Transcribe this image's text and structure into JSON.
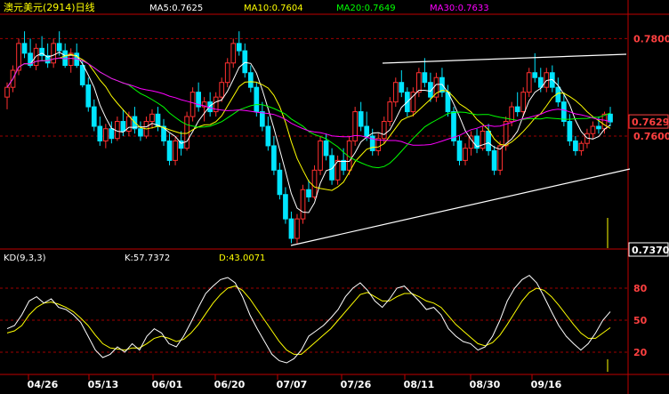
{
  "header": {
    "title": "澳元美元(2914)日线",
    "ma": [
      {
        "label": "MA5:0.7625",
        "color": "#ffffff"
      },
      {
        "label": "MA10:0.7604",
        "color": "#ffff00"
      },
      {
        "label": "MA20:0.7649",
        "color": "#00ff00"
      },
      {
        "label": "MA30:0.7633",
        "color": "#ff00ff"
      }
    ]
  },
  "kd_header": {
    "name": "KD(9,3,3)",
    "k_label": "K:57.7372",
    "d_label": "D:43.0071"
  },
  "price_axis": {
    "labels": [
      {
        "text": "0.7629",
        "value": 0.7629,
        "boxed": true,
        "color": "#ff4040"
      },
      {
        "text": "0.7800",
        "value": 0.78,
        "color": "#ff4040"
      },
      {
        "text": "0.7600",
        "value": 0.76,
        "color": "#ff4040"
      },
      {
        "text": "0.7370",
        "value": 0.737,
        "boxed": true,
        "color": "#ffffff"
      }
    ]
  },
  "kd_axis": {
    "labels": [
      {
        "text": "80",
        "value": 80
      },
      {
        "text": "50",
        "value": 50
      },
      {
        "text": "20",
        "value": 20
      }
    ]
  },
  "date_axis": [
    "04/26",
    "05/13",
    "06/01",
    "06/20",
    "07/07",
    "07/26",
    "08/11",
    "08/30",
    "09/16"
  ],
  "colors": {
    "up": "#ff3030",
    "down": "#00e5ff",
    "grid": "#a00000",
    "trend": "#ffffff"
  },
  "chart_data": {
    "type": "candlestick",
    "title": "澳元美元(2914)日线",
    "price_range": [
      0.737,
      0.785
    ],
    "kd_range": [
      0,
      100
    ],
    "categories": [
      "04/26",
      "05/13",
      "06/01",
      "06/20",
      "07/07",
      "07/26",
      "08/11",
      "08/30",
      "09/16"
    ],
    "candles": [
      [
        0.768,
        0.771,
        0.7655,
        0.77
      ],
      [
        0.77,
        0.7745,
        0.769,
        0.7735
      ],
      [
        0.7735,
        0.78,
        0.7725,
        0.779
      ],
      [
        0.779,
        0.7815,
        0.776,
        0.777
      ],
      [
        0.777,
        0.78,
        0.774,
        0.7745
      ],
      [
        0.7745,
        0.779,
        0.7735,
        0.778
      ],
      [
        0.778,
        0.7805,
        0.7755,
        0.7765
      ],
      [
        0.7765,
        0.779,
        0.774,
        0.775
      ],
      [
        0.775,
        0.78,
        0.774,
        0.779
      ],
      [
        0.779,
        0.7815,
        0.7765,
        0.7775
      ],
      [
        0.7775,
        0.779,
        0.774,
        0.7745
      ],
      [
        0.7745,
        0.778,
        0.773,
        0.777
      ],
      [
        0.777,
        0.779,
        0.774,
        0.7745
      ],
      [
        0.7745,
        0.7755,
        0.77,
        0.7705
      ],
      [
        0.7705,
        0.772,
        0.765,
        0.766
      ],
      [
        0.766,
        0.7675,
        0.761,
        0.762
      ],
      [
        0.762,
        0.764,
        0.758,
        0.759
      ],
      [
        0.759,
        0.7625,
        0.7575,
        0.7615
      ],
      [
        0.7615,
        0.763,
        0.7585,
        0.7595
      ],
      [
        0.7595,
        0.764,
        0.759,
        0.763
      ],
      [
        0.763,
        0.7655,
        0.76,
        0.761
      ],
      [
        0.761,
        0.765,
        0.76,
        0.764
      ],
      [
        0.764,
        0.766,
        0.7605,
        0.7615
      ],
      [
        0.7615,
        0.763,
        0.759,
        0.76
      ],
      [
        0.76,
        0.764,
        0.7595,
        0.763
      ],
      [
        0.763,
        0.7655,
        0.7615,
        0.7645
      ],
      [
        0.7645,
        0.766,
        0.761,
        0.762
      ],
      [
        0.762,
        0.7635,
        0.758,
        0.759
      ],
      [
        0.759,
        0.7605,
        0.754,
        0.755
      ],
      [
        0.755,
        0.76,
        0.754,
        0.759
      ],
      [
        0.759,
        0.761,
        0.756,
        0.7575
      ],
      [
        0.7575,
        0.765,
        0.757,
        0.764
      ],
      [
        0.764,
        0.77,
        0.763,
        0.769
      ],
      [
        0.769,
        0.771,
        0.765,
        0.766
      ],
      [
        0.766,
        0.768,
        0.763,
        0.767
      ],
      [
        0.767,
        0.769,
        0.764,
        0.765
      ],
      [
        0.765,
        0.769,
        0.764,
        0.768
      ],
      [
        0.768,
        0.772,
        0.767,
        0.771
      ],
      [
        0.771,
        0.776,
        0.77,
        0.775
      ],
      [
        0.775,
        0.78,
        0.774,
        0.779
      ],
      [
        0.779,
        0.7815,
        0.7765,
        0.7775
      ],
      [
        0.7775,
        0.779,
        0.772,
        0.773
      ],
      [
        0.773,
        0.7745,
        0.769,
        0.77
      ],
      [
        0.77,
        0.771,
        0.764,
        0.765
      ],
      [
        0.765,
        0.767,
        0.761,
        0.762
      ],
      [
        0.762,
        0.764,
        0.757,
        0.758
      ],
      [
        0.758,
        0.76,
        0.752,
        0.753
      ],
      [
        0.753,
        0.7545,
        0.747,
        0.748
      ],
      [
        0.748,
        0.7495,
        0.742,
        0.743
      ],
      [
        0.743,
        0.7445,
        0.738,
        0.739
      ],
      [
        0.739,
        0.744,
        0.738,
        0.743
      ],
      [
        0.743,
        0.75,
        0.742,
        0.749
      ],
      [
        0.749,
        0.751,
        0.7465,
        0.7475
      ],
      [
        0.7475,
        0.754,
        0.747,
        0.753
      ],
      [
        0.753,
        0.76,
        0.752,
        0.759
      ],
      [
        0.759,
        0.7605,
        0.755,
        0.756
      ],
      [
        0.756,
        0.7575,
        0.75,
        0.751
      ],
      [
        0.751,
        0.756,
        0.75,
        0.755
      ],
      [
        0.755,
        0.7575,
        0.752,
        0.753
      ],
      [
        0.753,
        0.76,
        0.752,
        0.759
      ],
      [
        0.759,
        0.766,
        0.758,
        0.765
      ],
      [
        0.765,
        0.767,
        0.761,
        0.762
      ],
      [
        0.762,
        0.765,
        0.759,
        0.76
      ],
      [
        0.76,
        0.7615,
        0.756,
        0.757
      ],
      [
        0.757,
        0.7605,
        0.756,
        0.7595
      ],
      [
        0.7595,
        0.764,
        0.7585,
        0.763
      ],
      [
        0.763,
        0.768,
        0.762,
        0.767
      ],
      [
        0.767,
        0.772,
        0.766,
        0.771
      ],
      [
        0.771,
        0.7735,
        0.768,
        0.769
      ],
      [
        0.769,
        0.77,
        0.764,
        0.765
      ],
      [
        0.765,
        0.77,
        0.764,
        0.769
      ],
      [
        0.769,
        0.774,
        0.768,
        0.773
      ],
      [
        0.773,
        0.776,
        0.77,
        0.771
      ],
      [
        0.771,
        0.773,
        0.767,
        0.768
      ],
      [
        0.768,
        0.773,
        0.767,
        0.772
      ],
      [
        0.772,
        0.774,
        0.768,
        0.769
      ],
      [
        0.769,
        0.7705,
        0.764,
        0.765
      ],
      [
        0.765,
        0.766,
        0.758,
        0.759
      ],
      [
        0.759,
        0.76,
        0.754,
        0.755
      ],
      [
        0.755,
        0.7585,
        0.754,
        0.7575
      ],
      [
        0.7575,
        0.761,
        0.756,
        0.76
      ],
      [
        0.76,
        0.7615,
        0.7565,
        0.7575
      ],
      [
        0.7575,
        0.762,
        0.757,
        0.761
      ],
      [
        0.761,
        0.7625,
        0.756,
        0.757
      ],
      [
        0.757,
        0.758,
        0.752,
        0.753
      ],
      [
        0.753,
        0.759,
        0.752,
        0.758
      ],
      [
        0.758,
        0.764,
        0.757,
        0.763
      ],
      [
        0.763,
        0.767,
        0.762,
        0.766
      ],
      [
        0.766,
        0.769,
        0.764,
        0.765
      ],
      [
        0.765,
        0.77,
        0.764,
        0.769
      ],
      [
        0.769,
        0.774,
        0.768,
        0.773
      ],
      [
        0.773,
        0.777,
        0.771,
        0.772
      ],
      [
        0.772,
        0.774,
        0.769,
        0.77
      ],
      [
        0.77,
        0.774,
        0.769,
        0.773
      ],
      [
        0.773,
        0.7745,
        0.769,
        0.77
      ],
      [
        0.77,
        0.772,
        0.766,
        0.767
      ],
      [
        0.767,
        0.769,
        0.762,
        0.763
      ],
      [
        0.763,
        0.7645,
        0.758,
        0.759
      ],
      [
        0.759,
        0.76,
        0.756,
        0.757
      ],
      [
        0.757,
        0.759,
        0.756,
        0.7585
      ],
      [
        0.7585,
        0.7615,
        0.7575,
        0.7605
      ],
      [
        0.7605,
        0.763,
        0.7595,
        0.762
      ],
      [
        0.762,
        0.764,
        0.7605,
        0.7615
      ],
      [
        0.7615,
        0.765,
        0.7605,
        0.7645
      ],
      [
        0.7645,
        0.766,
        0.762,
        0.7629
      ]
    ],
    "kd": {
      "k": [
        42,
        45,
        55,
        68,
        72,
        66,
        70,
        62,
        60,
        55,
        48,
        35,
        22,
        15,
        18,
        25,
        20,
        28,
        22,
        35,
        42,
        38,
        28,
        25,
        35,
        48,
        62,
        75,
        82,
        88,
        90,
        85,
        72,
        55,
        42,
        30,
        18,
        12,
        10,
        14,
        22,
        35,
        40,
        45,
        52,
        60,
        72,
        80,
        85,
        78,
        68,
        62,
        70,
        80,
        82,
        75,
        68,
        60,
        62,
        55,
        42,
        35,
        30,
        28,
        22,
        25,
        35,
        50,
        68,
        80,
        88,
        92,
        85,
        72,
        58,
        45,
        35,
        28,
        22,
        28,
        38,
        50,
        58
      ],
      "d": [
        38,
        40,
        45,
        55,
        62,
        66,
        67,
        65,
        62,
        58,
        52,
        45,
        36,
        28,
        24,
        23,
        22,
        24,
        24,
        28,
        33,
        35,
        33,
        30,
        32,
        38,
        46,
        56,
        66,
        74,
        80,
        82,
        78,
        70,
        60,
        50,
        40,
        30,
        22,
        18,
        18,
        24,
        30,
        36,
        42,
        50,
        58,
        66,
        74,
        76,
        72,
        68,
        68,
        72,
        75,
        75,
        72,
        68,
        66,
        62,
        54,
        46,
        40,
        34,
        28,
        26,
        29,
        36,
        46,
        57,
        68,
        76,
        80,
        78,
        72,
        64,
        55,
        46,
        38,
        33,
        33,
        38,
        43
      ]
    },
    "ma_periods": [
      5,
      10,
      20,
      30
    ]
  }
}
